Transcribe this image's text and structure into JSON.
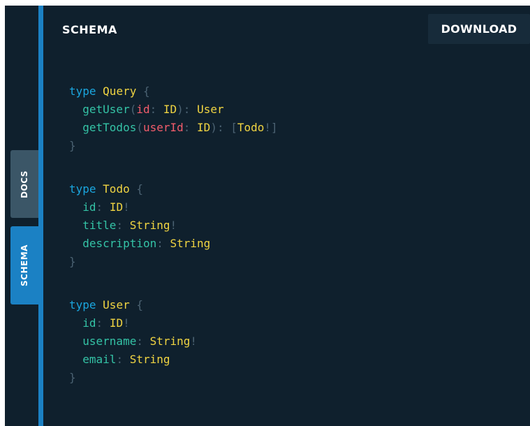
{
  "colors": {
    "background": "#0f202d",
    "accent": "#1b81c4",
    "tab_inactive": "#3b5667",
    "button_bg": "#172b3a",
    "keyword": "#1aa6df",
    "type": "#f0d442",
    "field": "#34c3a6",
    "arg": "#f25c6b",
    "punct": "#4b6272"
  },
  "side_tabs": [
    {
      "label": "DOCS",
      "active": false
    },
    {
      "label": "SCHEMA",
      "active": true
    }
  ],
  "header": {
    "title": "SCHEMA",
    "download_label": "DOWNLOAD"
  },
  "schema": {
    "blocks": [
      {
        "lines": [
          [
            [
              "kw",
              "type"
            ],
            [
              "sp",
              " "
            ],
            [
              "ty",
              "Query"
            ],
            [
              "sp",
              " "
            ],
            [
              "p",
              "{"
            ]
          ],
          [
            [
              "sp",
              "  "
            ],
            [
              "f",
              "getUser"
            ],
            [
              "p",
              "("
            ],
            [
              "a",
              "id"
            ],
            [
              "p",
              ":"
            ],
            [
              "sp",
              " "
            ],
            [
              "ty",
              "ID"
            ],
            [
              "p",
              ")"
            ],
            [
              "p",
              ":"
            ],
            [
              "sp",
              " "
            ],
            [
              "ty",
              "User"
            ]
          ],
          [
            [
              "sp",
              "  "
            ],
            [
              "f",
              "getTodos"
            ],
            [
              "p",
              "("
            ],
            [
              "a",
              "userId"
            ],
            [
              "p",
              ":"
            ],
            [
              "sp",
              " "
            ],
            [
              "ty",
              "ID"
            ],
            [
              "p",
              ")"
            ],
            [
              "p",
              ":"
            ],
            [
              "sp",
              " "
            ],
            [
              "p",
              "["
            ],
            [
              "ty",
              "Todo"
            ],
            [
              "p",
              "!"
            ],
            [
              "p",
              "]"
            ]
          ],
          [
            [
              "p",
              "}"
            ]
          ]
        ]
      },
      {
        "lines": [
          [
            [
              "kw",
              "type"
            ],
            [
              "sp",
              " "
            ],
            [
              "ty",
              "Todo"
            ],
            [
              "sp",
              " "
            ],
            [
              "p",
              "{"
            ]
          ],
          [
            [
              "sp",
              "  "
            ],
            [
              "f",
              "id"
            ],
            [
              "p",
              ":"
            ],
            [
              "sp",
              " "
            ],
            [
              "ty",
              "ID"
            ],
            [
              "p",
              "!"
            ]
          ],
          [
            [
              "sp",
              "  "
            ],
            [
              "f",
              "title"
            ],
            [
              "p",
              ":"
            ],
            [
              "sp",
              " "
            ],
            [
              "ty",
              "String"
            ],
            [
              "p",
              "!"
            ]
          ],
          [
            [
              "sp",
              "  "
            ],
            [
              "f",
              "description"
            ],
            [
              "p",
              ":"
            ],
            [
              "sp",
              " "
            ],
            [
              "ty",
              "String"
            ]
          ],
          [
            [
              "p",
              "}"
            ]
          ]
        ]
      },
      {
        "lines": [
          [
            [
              "kw",
              "type"
            ],
            [
              "sp",
              " "
            ],
            [
              "ty",
              "User"
            ],
            [
              "sp",
              " "
            ],
            [
              "p",
              "{"
            ]
          ],
          [
            [
              "sp",
              "  "
            ],
            [
              "f",
              "id"
            ],
            [
              "p",
              ":"
            ],
            [
              "sp",
              " "
            ],
            [
              "ty",
              "ID"
            ],
            [
              "p",
              "!"
            ]
          ],
          [
            [
              "sp",
              "  "
            ],
            [
              "f",
              "username"
            ],
            [
              "p",
              ":"
            ],
            [
              "sp",
              " "
            ],
            [
              "ty",
              "String"
            ],
            [
              "p",
              "!"
            ]
          ],
          [
            [
              "sp",
              "  "
            ],
            [
              "f",
              "email"
            ],
            [
              "p",
              ":"
            ],
            [
              "sp",
              " "
            ],
            [
              "ty",
              "String"
            ]
          ],
          [
            [
              "p",
              "}"
            ]
          ]
        ]
      }
    ]
  }
}
